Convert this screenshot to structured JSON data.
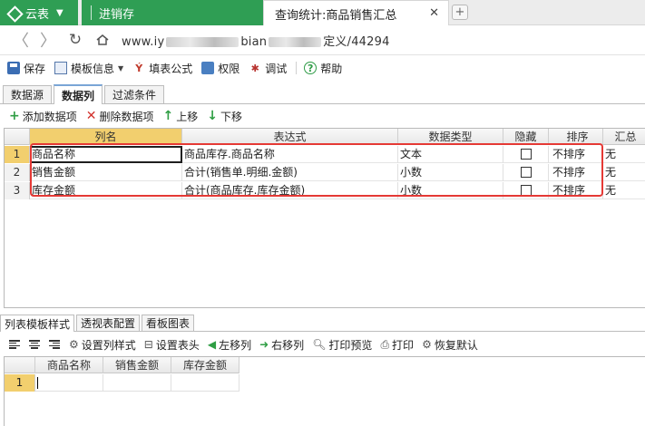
{
  "browser": {
    "app_tab_label": "云表",
    "tab_inactive_label": "进销存",
    "tab_active_label": "查询统计:商品销售汇总",
    "url_prefix": "www.iy",
    "url_mid": "bian",
    "url_suffix": "定义/44294"
  },
  "toolbar": {
    "save": "保存",
    "template_info": "模板信息",
    "fill_formula": "填表公式",
    "permission": "权限",
    "debug": "调试",
    "help": "帮助"
  },
  "section_tabs": [
    "数据源",
    "数据列",
    "过滤条件"
  ],
  "column_toolbar": {
    "add": "添加数据项",
    "delete": "删除数据项",
    "up": "上移",
    "down": "下移"
  },
  "grid": {
    "headers": [
      "列名",
      "表达式",
      "数据类型",
      "隐藏",
      "排序",
      "汇总"
    ],
    "rows": [
      {
        "n": "1",
        "name": "商品名称",
        "expr": "商品库存.商品名称",
        "type": "文本",
        "hidden": false,
        "sort": "不排序",
        "sum": "无"
      },
      {
        "n": "2",
        "name": "销售金额",
        "expr": "合计(销售单.明细.金额)",
        "type": "小数",
        "hidden": false,
        "sort": "不排序",
        "sum": "无"
      },
      {
        "n": "3",
        "name": "库存金额",
        "expr": "合计(商品库存.库存金额)",
        "type": "小数",
        "hidden": false,
        "sort": "不排序",
        "sum": "无"
      }
    ]
  },
  "bottom_tabs": [
    "列表模板样式",
    "透视表配置",
    "看板图表"
  ],
  "bottom_toolbar": {
    "set_col_style": "设置列样式",
    "set_header": "设置表头",
    "move_left": "左移列",
    "move_right": "右移列",
    "print_preview": "打印预览",
    "print": "打印",
    "restore_default": "恢复默认"
  },
  "preview": {
    "headers": [
      "商品名称",
      "销售金额",
      "库存金额"
    ],
    "row_number": "1"
  },
  "colors": {
    "app_green": "#2f9e54",
    "highlight_box": "#e53935",
    "selected_header": "#f2cf6e"
  }
}
